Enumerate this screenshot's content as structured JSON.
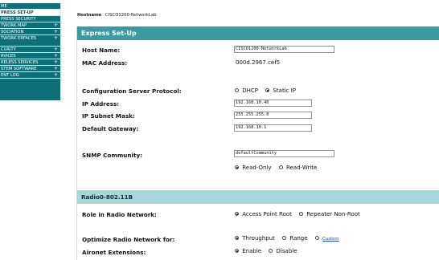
{
  "nav": {
    "items": [
      {
        "label": "ME",
        "plus": ""
      },
      {
        "label": "PRESS SET-UP",
        "plus": ""
      },
      {
        "label": "PRESS SECURITY",
        "plus": ""
      },
      {
        "label": "TWORK MAP",
        "plus": "+"
      },
      {
        "label": "SOCIATION",
        "plus": "+"
      },
      {
        "label": "TWORK ERFACES",
        "plus": "+"
      },
      {
        "label": "CURITY",
        "plus": "+"
      },
      {
        "label": "RVICES",
        "plus": "+"
      },
      {
        "label": "RELESS SERVICES",
        "plus": "+"
      },
      {
        "label": "STEM SOFTWARE",
        "plus": "+"
      },
      {
        "label": "ENT LOG",
        "plus": "+"
      }
    ]
  },
  "header": {
    "hostname_label": "Hostname",
    "hostname_value": "CISCO1200-NetworkLab"
  },
  "express_setup": {
    "title": "Express Set-Up",
    "host_name_label": "Host Name:",
    "host_name_value": "CISCO1200-NetworkLab",
    "mac_label": "MAC Address:",
    "mac_value": "000d.2967.cef5",
    "config_protocol_label": "Configuration Server Protocol:",
    "dhcp_label": "DHCP",
    "static_ip_label": "Static IP",
    "ip_label": "IP Address:",
    "ip_value": "192.168.10.40",
    "subnet_label": "IP Subnet Mask:",
    "subnet_value": "255.255.255.0",
    "gateway_label": "Default Gateway:",
    "gateway_value": "192.168.10.1",
    "snmp_label": "SNMP Community:",
    "snmp_value": "defaultCommunity",
    "read_only_label": "Read-Only",
    "read_write_label": "Read-Write"
  },
  "radio_section": {
    "title": "Radio0-802.11B",
    "role_label": "Role in Radio Network:",
    "ap_root_label": "Access Point Root",
    "repeater_label": "Repeater Non-Root",
    "optimize_label": "Optimize Radio Network for:",
    "throughput_label": "Throughput",
    "range_label": "Range",
    "custom_label": "Custom",
    "aironet_label": "Aironet Extensions:",
    "enable_label": "Enable",
    "disable_label": "Disable"
  },
  "colors": {
    "nav_background": "#0f6f79",
    "section_header": "#3c9ba2",
    "subsection_header": "#a9d6da",
    "link": "#1d49b2"
  }
}
